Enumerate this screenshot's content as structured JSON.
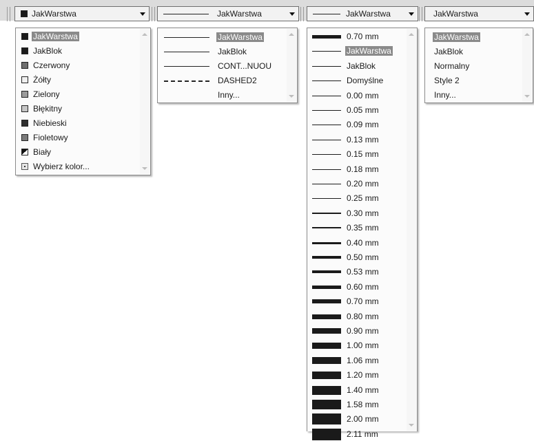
{
  "combos": {
    "color_value": "JakWarstwa",
    "linetype_value": "JakWarstwa",
    "lineweight_value": "JakWarstwa",
    "plotstyle_value": "JakWarstwa"
  },
  "color_list": [
    {
      "label": "JakWarstwa",
      "swatch": "#1a1a1a",
      "selected": true
    },
    {
      "label": "JakBlok",
      "swatch": "#1a1a1a"
    },
    {
      "label": "Czerwony",
      "swatch": "#6f6f6f"
    },
    {
      "label": "Żółty",
      "swatch": "#f0f0f0"
    },
    {
      "label": "Zielony",
      "swatch": "#9c9c9c"
    },
    {
      "label": "Błękitny",
      "swatch": "#c6c6c6"
    },
    {
      "label": "Niebieski",
      "swatch": "#2e2e2e"
    },
    {
      "label": "Fioletowy",
      "swatch": "#7a7a7a"
    },
    {
      "label": "Biały",
      "swatch": "split"
    },
    {
      "label": "Wybierz kolor...",
      "swatch": "chooser"
    }
  ],
  "linetype_list": [
    {
      "label": "JakWarstwa",
      "line": "solid",
      "selected": true
    },
    {
      "label": "JakBlok",
      "line": "solid"
    },
    {
      "label": "CONT...NUOU",
      "line": "solid"
    },
    {
      "label": "DASHED2",
      "line": "dashed"
    },
    {
      "label": "Inny...",
      "line": "none"
    }
  ],
  "lineweight_list": [
    {
      "label": "0.70 mm",
      "w": 5
    },
    {
      "label": "JakWarstwa",
      "w": 1,
      "selected": true
    },
    {
      "label": "JakBlok",
      "w": 1
    },
    {
      "label": "Domyślne",
      "w": 1
    },
    {
      "label": "0.00 mm",
      "w": 1
    },
    {
      "label": "0.05 mm",
      "w": 1
    },
    {
      "label": "0.09 mm",
      "w": 1
    },
    {
      "label": "0.13 mm",
      "w": 1
    },
    {
      "label": "0.15 mm",
      "w": 1
    },
    {
      "label": "0.18 mm",
      "w": 1
    },
    {
      "label": "0.20 mm",
      "w": 1
    },
    {
      "label": "0.25 mm",
      "w": 1
    },
    {
      "label": "0.30 mm",
      "w": 2
    },
    {
      "label": "0.35 mm",
      "w": 2
    },
    {
      "label": "0.40 mm",
      "w": 3
    },
    {
      "label": "0.50 mm",
      "w": 4
    },
    {
      "label": "0.53 mm",
      "w": 4
    },
    {
      "label": "0.60 mm",
      "w": 5
    },
    {
      "label": "0.70 mm",
      "w": 6
    },
    {
      "label": "0.80 mm",
      "w": 7
    },
    {
      "label": "0.90 mm",
      "w": 8
    },
    {
      "label": "1.00 mm",
      "w": 9
    },
    {
      "label": "1.06 mm",
      "w": 10
    },
    {
      "label": "1.20 mm",
      "w": 11
    },
    {
      "label": "1.40 mm",
      "w": 13
    },
    {
      "label": "1.58 mm",
      "w": 14
    },
    {
      "label": "2.00 mm",
      "w": 16
    },
    {
      "label": "2.11 mm",
      "w": 17
    }
  ],
  "plotstyle_list": [
    {
      "label": "JakWarstwa",
      "selected": true
    },
    {
      "label": "JakBlok"
    },
    {
      "label": "Normalny"
    },
    {
      "label": "Style 2"
    },
    {
      "label": "Inny..."
    }
  ]
}
